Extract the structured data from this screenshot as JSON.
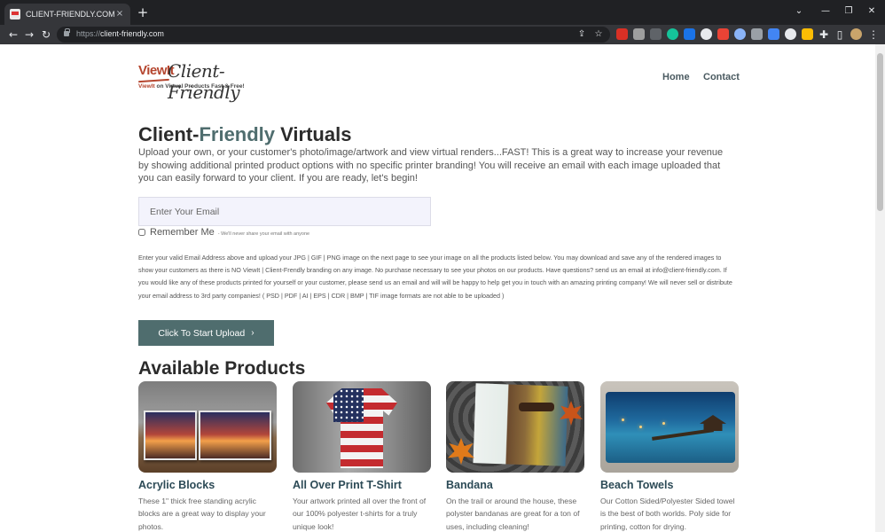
{
  "browser": {
    "tab_title": "CLIENT-FRIENDLY.COM - Virtual",
    "url_scheme": "https://",
    "url_host": "client-friendly.com"
  },
  "logo": {
    "brand": "ViewIt",
    "script": "Client-Friendly",
    "tagline_brand": "ViewIt",
    "tagline_rest": " on Virtual Products Fast & Free!"
  },
  "nav": {
    "home": "Home",
    "contact": "Contact"
  },
  "hero": {
    "title_part1": "Client-",
    "title_accent": "Friendly",
    "title_part2": " Virtuals",
    "intro": "Upload your own, or your customer's photo/image/artwork and view virtual renders...FAST! This is a great way to increase your revenue by showing additional printed product options with no specific printer branding! You will receive an email with each image uploaded that you can easily forward to your client. If you are ready, let's begin!"
  },
  "form": {
    "email_placeholder": "Enter Your Email",
    "remember_label": "Remember Me",
    "remember_note": "- We'll never share your email with anyone",
    "fineprint": "Enter your valid Email Address above and upload your JPG | GIF | PNG image on the next page to see your image on all the products listed below. You may download and save any of the rendered images to show your customers as there is NO ViewIt | Client-Frendly branding on any image. No purchase necessary to see your photos on our products. Have questions? send us an email at info@client-friendly.com. If you would like any of these products printed for yourself or your customer, please send us an email and will will be happy to help get you in touch with an amazing printing company! We will never sell or distribute your email address to 3rd party companies! ( PSD | PDF | AI | EPS | CDR | BMP | TIF image formats are not able to be uploaded )",
    "upload_button": "Click To Start Upload",
    "upload_chevron": "›"
  },
  "products": {
    "heading": "Available Products",
    "items": [
      {
        "title": "Acrylic Blocks",
        "desc": "These 1\" thick free standing acrylic blocks are a great way to display your photos."
      },
      {
        "title": "All Over Print T-Shirt",
        "desc": "Your artwork printed all over the front of our 100% polyester t-shirts for a truly unique look!"
      },
      {
        "title": "Bandana",
        "desc": "On the trail or around the house, these polyster bandanas are great for a ton of uses, including cleaning!"
      },
      {
        "title": "Beach Towels",
        "desc": "Our Cotton Sided/Polyester Sided towel is the best of both worlds. Poly side for printing, cotton for drying."
      }
    ]
  },
  "icons": {
    "back": "←",
    "forward": "→",
    "reload": "↻",
    "new_tab": "+",
    "close_tab": "×",
    "minimize": "⌄",
    "chevron_menu": "—",
    "restore": "❐",
    "close": "✕",
    "share": "⇪",
    "star": "☆",
    "puzzle": "✚",
    "sidebar": "▯",
    "menu": "⋮"
  },
  "colors": {
    "accent": "#4f6d6e",
    "heading": "#2b2b2b",
    "product_title": "#2c4a56",
    "logo_red": "#b5452e"
  }
}
